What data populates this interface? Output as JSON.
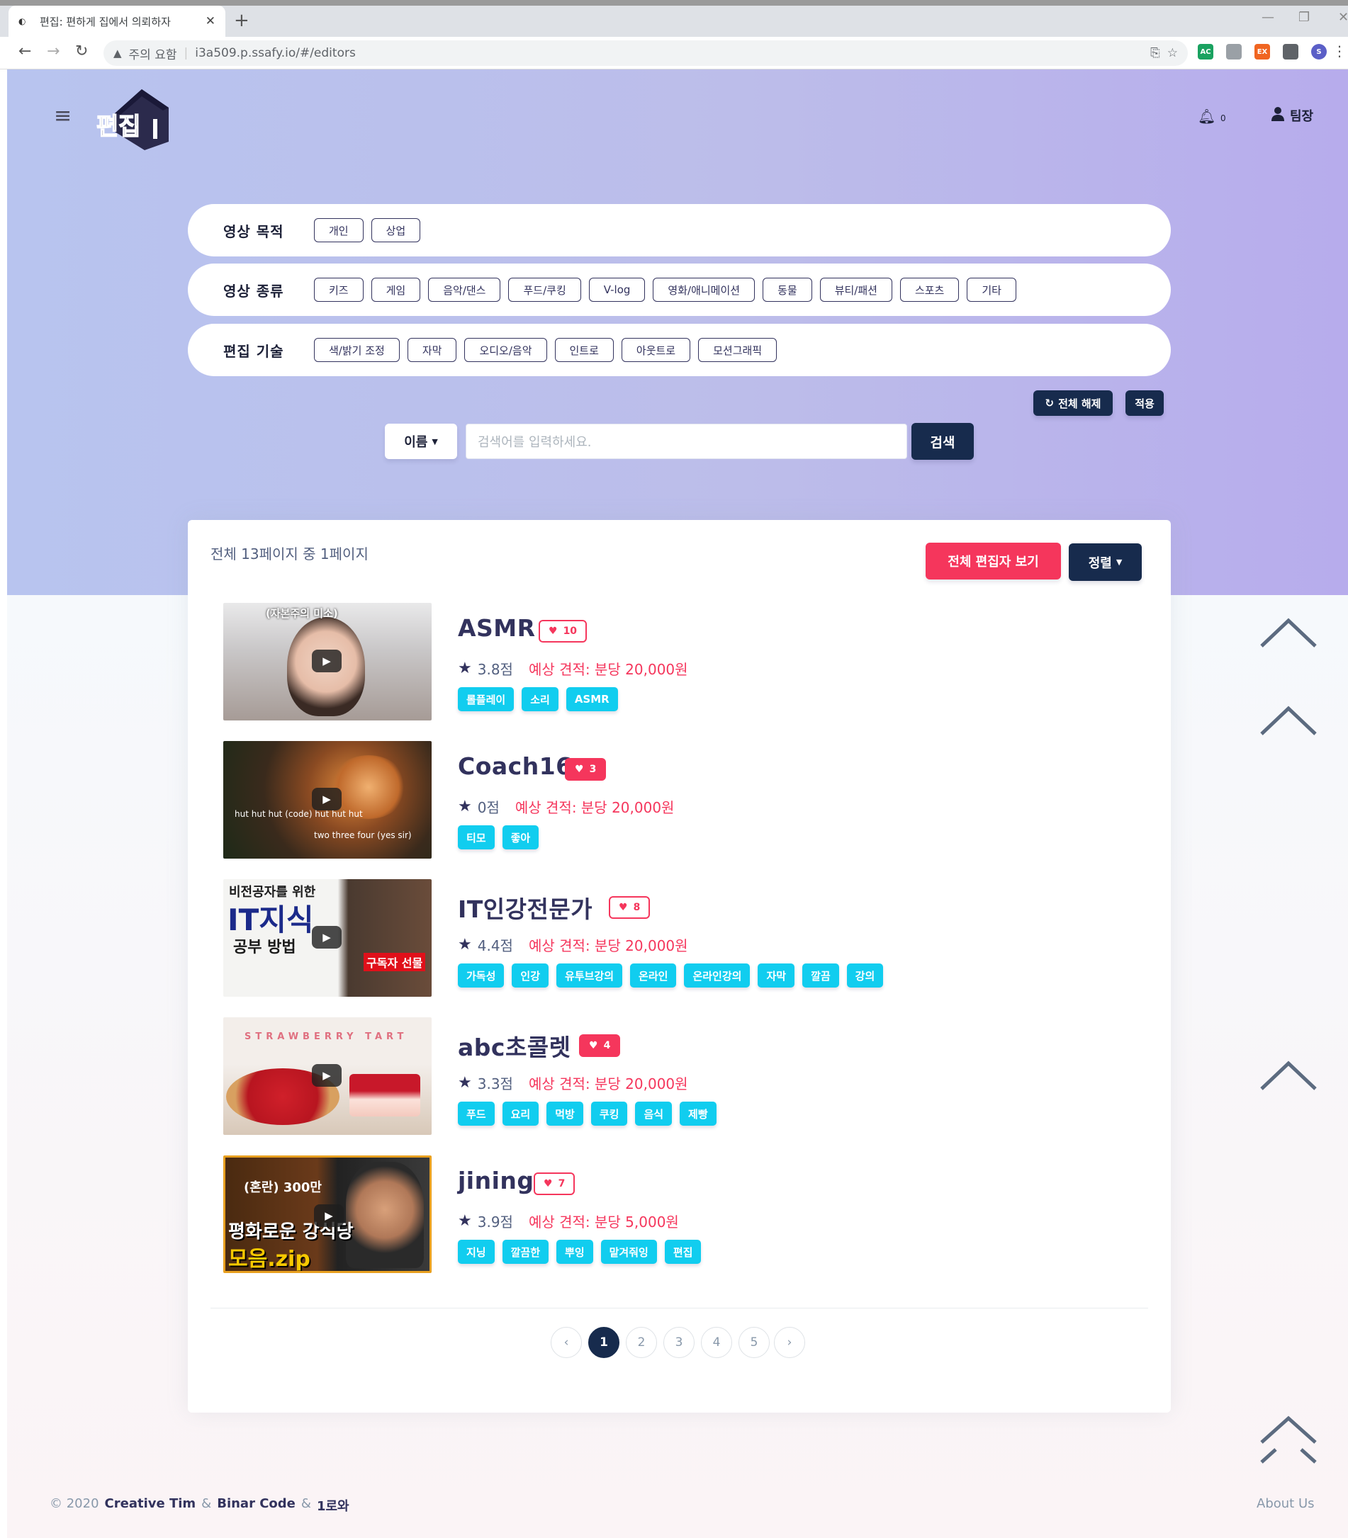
{
  "browser": {
    "tab_title": "편집: 편하게 집에서 의뢰하자",
    "new_tab": "+",
    "tab_close": "✕",
    "security_label": "주의 요함",
    "url": "i3a509.p.ssafy.io/#/editors",
    "extensions": [
      {
        "label": "AC",
        "color": "#1aa260"
      },
      {
        "label": "",
        "color": "#9aa0a6"
      },
      {
        "label": "EX",
        "color": "#f06521"
      },
      {
        "label": "",
        "color": "#5f6368"
      },
      {
        "label": "S",
        "color": "#5b5fc7"
      }
    ]
  },
  "header": {
    "menu_icon": "hamburger-icon",
    "logo_text": "편집",
    "notification_count": "0",
    "user_label": "팀장"
  },
  "filters": [
    {
      "label": "영상 목적",
      "options": [
        "개인",
        "상업"
      ]
    },
    {
      "label": "영상 종류",
      "options": [
        "키즈",
        "게임",
        "음악/댄스",
        "푸드/쿠킹",
        "V-log",
        "영화/애니메이션",
        "동물",
        "뷰티/패션",
        "스포츠",
        "기타"
      ]
    },
    {
      "label": "편집 기술",
      "options": [
        "색/밝기 조정",
        "자막",
        "오디오/음악",
        "인트로",
        "아웃트로",
        "모션그래픽"
      ]
    }
  ],
  "filter_actions": {
    "reset_label": "전체 해제",
    "apply_label": "적용"
  },
  "search": {
    "type_label": "이름",
    "placeholder": "검색어를 입력하세요.",
    "button_label": "검색"
  },
  "results": {
    "page_info": "전체 13페이지 중 1페이지",
    "view_all_label": "전체 편집자 보기",
    "sort_label": "정렬"
  },
  "editors": [
    {
      "name": "ASMR",
      "likes": "10",
      "likes_filled": false,
      "rating": "3.8점",
      "price": "예상 견적: 분당 20,000원",
      "tags": [
        "롤플레이",
        "소리",
        "ASMR"
      ],
      "thumb_caption": "(자본주의 미소)"
    },
    {
      "name": "Coach16",
      "likes": "3",
      "likes_filled": true,
      "rating": "0점",
      "price": "예상 견적: 분당 20,000원",
      "tags": [
        "티모",
        "좋아"
      ],
      "thumb_caption": "hut hut hut (code) hut hut hut",
      "thumb_caption2": "two three four (yes sir)"
    },
    {
      "name": "IT인강전문가",
      "likes": "8",
      "likes_filled": false,
      "rating": "4.4점",
      "price": "예상 견적: 분당 20,000원",
      "tags": [
        "가독성",
        "인강",
        "유투브강의",
        "온라인",
        "온라인강의",
        "자막",
        "깔끔",
        "강의"
      ],
      "thumb_caption": "비전공자를 위한",
      "thumb_caption2": "IT지식",
      "thumb_caption3": "공부 방법",
      "thumb_caption4": "구독자 선물"
    },
    {
      "name": "abc초콜렛",
      "likes": "4",
      "likes_filled": true,
      "rating": "3.3점",
      "price": "예상 견적: 분당 20,000원",
      "tags": [
        "푸드",
        "요리",
        "먹방",
        "쿠킹",
        "음식",
        "제빵"
      ],
      "thumb_caption": "STRAWBERRY TART"
    },
    {
      "name": "jining",
      "likes": "7",
      "likes_filled": false,
      "rating": "3.9점",
      "price": "예상 견적: 분당 5,000원",
      "tags": [
        "지닝",
        "깔끔한",
        "뿌잉",
        "맡겨줘잉",
        "편집"
      ],
      "thumb_caption": "(혼란) 300만",
      "thumb_caption2": "평화로운 강식당",
      "thumb_caption3": "모음.zip"
    }
  ],
  "pagination": {
    "prev_icon": "chevron-left-icon",
    "next_icon": "chevron-right-icon",
    "pages": [
      "1",
      "2",
      "3",
      "4",
      "5"
    ],
    "active": "1"
  },
  "footer": {
    "copyright": "© 2020",
    "author1": "Creative Tim",
    "sep1": "&",
    "author2": "Binar Code",
    "sep2": "&",
    "author3": "1로와",
    "link": "About Us"
  }
}
